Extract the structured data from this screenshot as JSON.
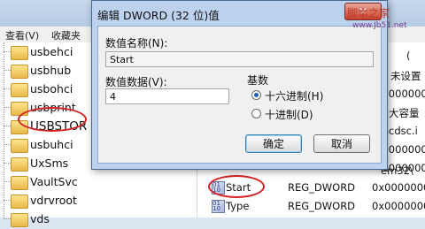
{
  "menubar": {
    "view": "查看(V)",
    "favorites": "收藏夹"
  },
  "tree": {
    "items": [
      "usbehci",
      "usbhub",
      "usbohci",
      "usbprint",
      "USBSTOR",
      "usbuhci",
      "UxSms",
      "VaultSvc",
      "vdrvroot",
      "vds"
    ]
  },
  "right_pane": {
    "partial_texts": [
      "(",
      "未设置",
      "x000000",
      "大容量",
      "scdsc.i",
      "x000000",
      "x000000",
      "em32\\"
    ],
    "rows": [
      {
        "icon": "reg-dword-icon",
        "name": "Start",
        "type": "REG_DWORD",
        "data": "0x0000000"
      },
      {
        "icon": "reg-dword-icon",
        "name": "Type",
        "type": "REG_DWORD",
        "data": "0x0000000"
      }
    ]
  },
  "dialog": {
    "title": "编辑 DWORD (32 位)值",
    "close_label": "✕",
    "value_name_label": "数值名称(N):",
    "value_name": "Start",
    "value_data_label": "数值数据(V):",
    "value_data": "4",
    "base_label": "基数",
    "radio_hex": "十六进制(H)",
    "radio_dec": "十进制(D)",
    "ok_label": "确定",
    "cancel_label": "取消"
  },
  "watermark": {
    "line1": "脚本之家",
    "line2": "www.Jb51.net"
  }
}
